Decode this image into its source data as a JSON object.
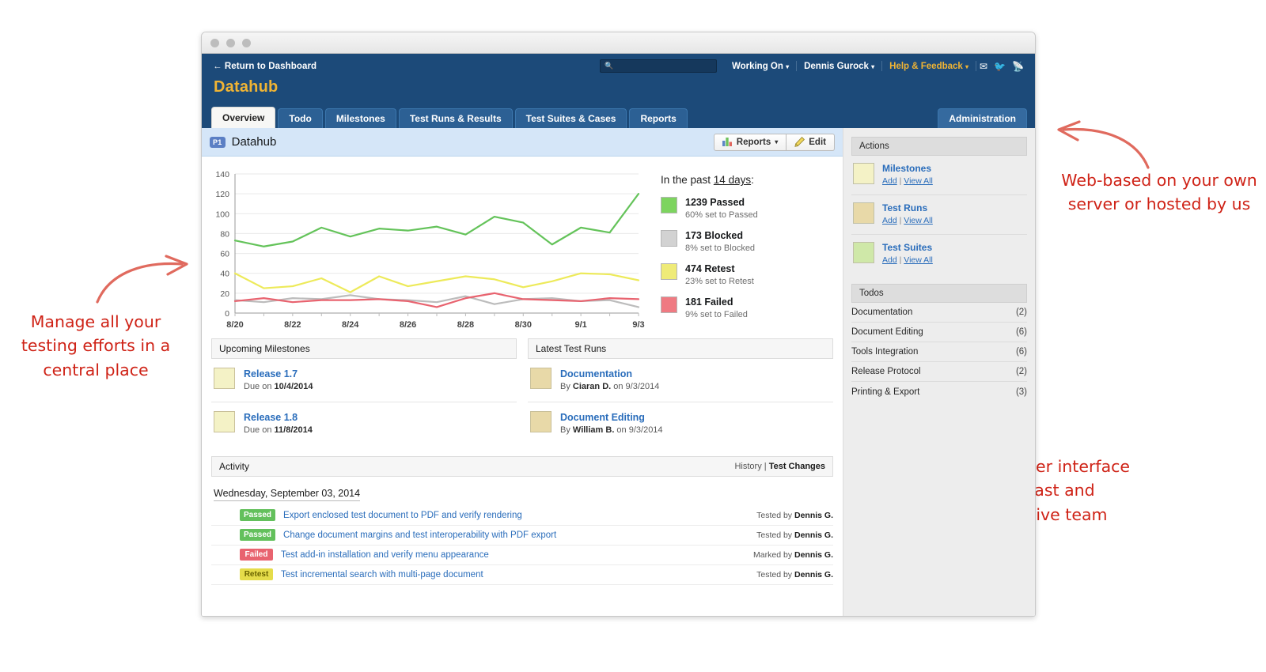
{
  "window": {
    "dots": 3
  },
  "header": {
    "return_label": "← Return to Dashboard",
    "brand": "Datahub",
    "search_placeholder": "",
    "search_value": "",
    "search_icon": "search-icon",
    "working_on": "Working On",
    "user": "Dennis Gurock",
    "help": "Help & Feedback",
    "mail_icon": "mail-icon",
    "twitter_icon": "twitter-icon",
    "rss_icon": "rss-icon",
    "caret": "▾"
  },
  "tabs": [
    {
      "label": "Overview",
      "active": true
    },
    {
      "label": "Todo",
      "active": false
    },
    {
      "label": "Milestones",
      "active": false
    },
    {
      "label": "Test Runs & Results",
      "active": false
    },
    {
      "label": "Test Suites & Cases",
      "active": false
    },
    {
      "label": "Reports",
      "active": false
    }
  ],
  "admin_tab": "Administration",
  "project": {
    "badge": "P1",
    "title": "Datahub",
    "reports_button": "Reports",
    "reports_caret": "▾",
    "edit_button": "Edit",
    "chart_icon": "bar-chart-icon",
    "pencil_icon": "pencil-icon"
  },
  "chart_data": {
    "type": "line",
    "title": "",
    "xlabel": "",
    "ylabel": "",
    "ylim": [
      0,
      140
    ],
    "yticks": [
      0,
      20,
      40,
      60,
      80,
      100,
      120,
      140
    ],
    "grid": true,
    "legend_position": "right",
    "x": [
      "8/20",
      "8/21",
      "8/22",
      "8/23",
      "8/24",
      "8/25",
      "8/26",
      "8/27",
      "8/28",
      "8/29",
      "8/30",
      "8/31",
      "9/1",
      "9/2",
      "9/3"
    ],
    "xtick_labels": [
      "8/20",
      "8/22",
      "8/24",
      "8/26",
      "8/28",
      "8/30",
      "9/1",
      "9/3"
    ],
    "series": [
      {
        "name": "Passed",
        "color": "#64c35a",
        "values": [
          73,
          67,
          72,
          86,
          77,
          85,
          83,
          87,
          79,
          97,
          91,
          69,
          86,
          81,
          120
        ]
      },
      {
        "name": "Retest",
        "color": "#edea5a",
        "values": [
          40,
          25,
          27,
          35,
          21,
          37,
          27,
          32,
          37,
          34,
          26,
          32,
          40,
          39,
          33
        ]
      },
      {
        "name": "Failed",
        "color": "#e8636f",
        "values": [
          12,
          15,
          11,
          13,
          13,
          14,
          12,
          6,
          15,
          20,
          14,
          13,
          12,
          15,
          14
        ]
      },
      {
        "name": "Blocked",
        "color": "#bcbcbc",
        "values": [
          13,
          11,
          15,
          14,
          18,
          14,
          13,
          11,
          17,
          9,
          14,
          15,
          12,
          13,
          6
        ]
      }
    ]
  },
  "summary": {
    "heading_pre": "In the past ",
    "heading_em": "14 days",
    "heading_post": ":",
    "rows": [
      {
        "count": "1239 Passed",
        "sub": "60% set to Passed",
        "color": "#7dd45f"
      },
      {
        "count": "173 Blocked",
        "sub": "8% set to Blocked",
        "color": "#d2d2d2"
      },
      {
        "count": "474 Retest",
        "sub": "23% set to Retest",
        "color": "#efeb78"
      },
      {
        "count": "181 Failed",
        "sub": "9% set to Failed",
        "color": "#ef7a82"
      }
    ]
  },
  "milestones_panel": {
    "title": "Upcoming Milestones",
    "items": [
      {
        "name": "Release 1.7",
        "sub_pre": "Due on ",
        "sub_strong": "10/4/2014",
        "color": "#f4f2c6"
      },
      {
        "name": "Release 1.8",
        "sub_pre": "Due on ",
        "sub_strong": "11/8/2014",
        "color": "#f4f2c6"
      }
    ]
  },
  "testruns_panel": {
    "title": "Latest Test Runs",
    "items": [
      {
        "name": "Documentation",
        "sub_pre": "By ",
        "sub_strong": "Ciaran D.",
        "sub_post": " on 9/3/2014",
        "color": "#e8d9a8"
      },
      {
        "name": "Document Editing",
        "sub_pre": "By ",
        "sub_strong": "William B.",
        "sub_post": " on 9/3/2014",
        "color": "#e8d9a8"
      }
    ]
  },
  "activity": {
    "title": "Activity",
    "link_history": "History",
    "link_sep": " | ",
    "link_changes": "Test Changes",
    "date": "Wednesday, September 03, 2014",
    "rows": [
      {
        "status": "Passed",
        "color": "#63c05c",
        "text": "Export enclosed test document to PDF and verify rendering",
        "by_pre": "Tested by ",
        "by_strong": "Dennis G."
      },
      {
        "status": "Passed",
        "color": "#63c05c",
        "text": "Change document margins and test interoperability with PDF export",
        "by_pre": "Tested by ",
        "by_strong": "Dennis G."
      },
      {
        "status": "Failed",
        "color": "#e8636f",
        "text": "Test add-in installation and verify menu appearance",
        "by_pre": "Marked by ",
        "by_strong": "Dennis G."
      },
      {
        "status": "Retest",
        "color": "#e5dc4a",
        "text": "Test incremental search with multi-page document",
        "by_pre": "Tested by ",
        "by_strong": "Dennis G."
      }
    ]
  },
  "actions": {
    "title": "Actions",
    "items": [
      {
        "name": "Milestones",
        "add": "Add",
        "sep": " | ",
        "view": "View All",
        "color": "#f4f2c6"
      },
      {
        "name": "Test Runs",
        "add": "Add",
        "sep": " | ",
        "view": "View All",
        "color": "#e8d9a8"
      },
      {
        "name": "Test Suites",
        "add": "Add",
        "sep": " | ",
        "view": "View All",
        "color": "#cfe8a8"
      }
    ]
  },
  "todos": {
    "title": "Todos",
    "items": [
      {
        "name": "Documentation",
        "count": "(2)"
      },
      {
        "name": "Document Editing",
        "count": "(6)"
      },
      {
        "name": "Tools Integration",
        "count": "(6)"
      },
      {
        "name": "Release Protocol",
        "count": "(2)"
      },
      {
        "name": "Printing & Export",
        "count": "(3)"
      }
    ]
  },
  "annotations": {
    "color": "#cf2317",
    "left": "Manage all your testing efforts in a central place",
    "right": "Web-based on your own server or hosted by us",
    "bottom": "Modern user interface for a fast and productive team"
  }
}
